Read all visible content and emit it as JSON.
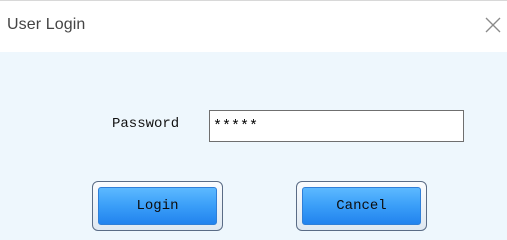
{
  "window": {
    "title": "User Login",
    "close_icon": "close-icon"
  },
  "form": {
    "password_label": "Password",
    "password_value": "*****"
  },
  "buttons": {
    "login_label": "Login",
    "cancel_label": "Cancel"
  },
  "colors": {
    "dialog_background": "#eef7fd",
    "titlebar_background": "#ffffff",
    "button_fill": "#3a9ef8"
  }
}
